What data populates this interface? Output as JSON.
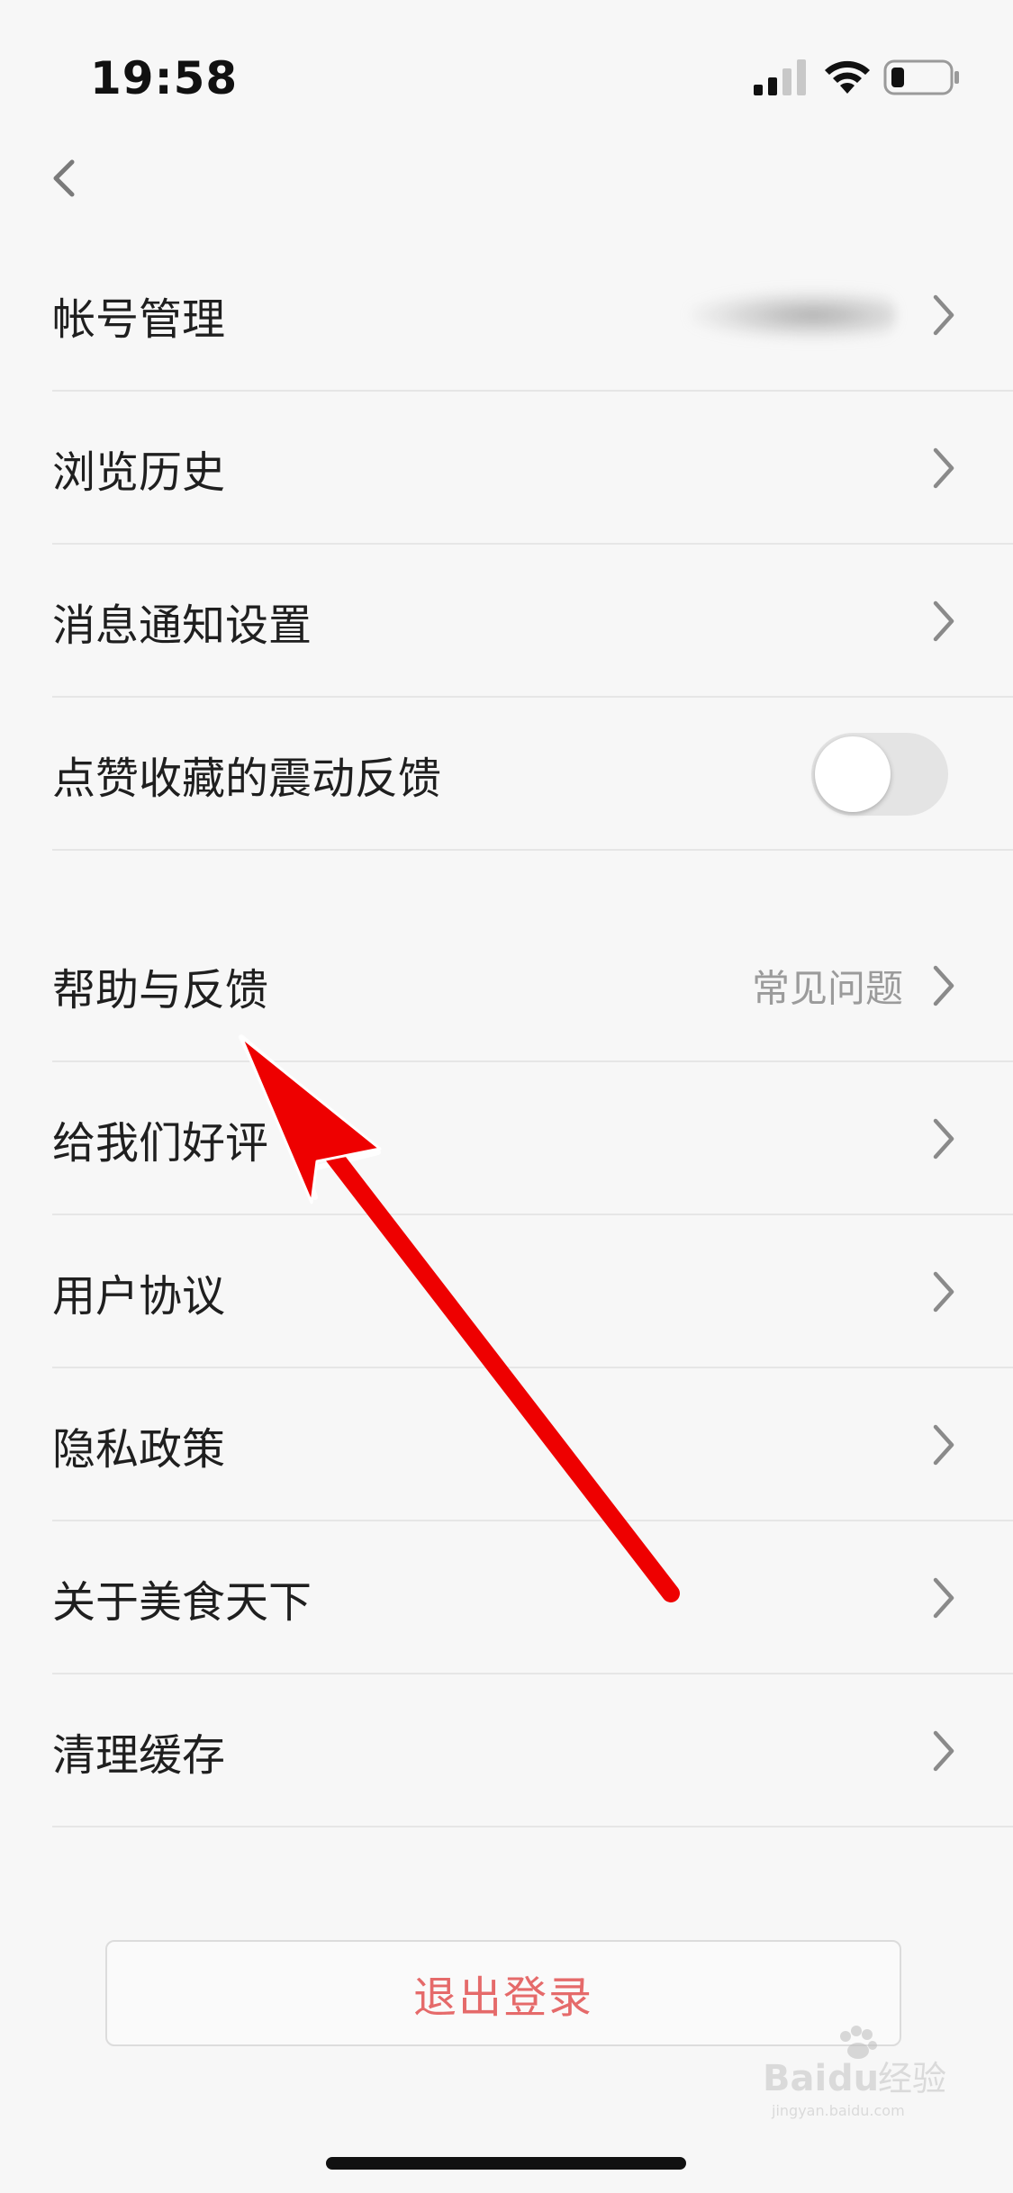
{
  "status_bar": {
    "time": "19:58"
  },
  "settings": {
    "rows": [
      {
        "label": "帐号管理",
        "type": "chevron",
        "value_blurred": true
      },
      {
        "label": "浏览历史",
        "type": "chevron"
      },
      {
        "label": "消息通知设置",
        "type": "chevron"
      },
      {
        "label": "点赞收藏的震动反馈",
        "type": "toggle",
        "toggle_on": false
      },
      {
        "label": "帮助与反馈",
        "type": "chevron",
        "value": "常见问题"
      },
      {
        "label": "给我们好评",
        "type": "chevron"
      },
      {
        "label": "用户协议",
        "type": "chevron"
      },
      {
        "label": "隐私政策",
        "type": "chevron"
      },
      {
        "label": "关于美食天下",
        "type": "chevron"
      },
      {
        "label": "清理缓存",
        "type": "chevron"
      }
    ]
  },
  "logout": {
    "label": "退出登录"
  },
  "watermark": {
    "text": "Baidu经验",
    "subtext": "jingyan.baidu.com"
  },
  "colors": {
    "background": "#f7f7f7",
    "logout_text": "#e56a6a",
    "arrow": "#ee0000",
    "secondary_text": "#9b9b9b"
  }
}
